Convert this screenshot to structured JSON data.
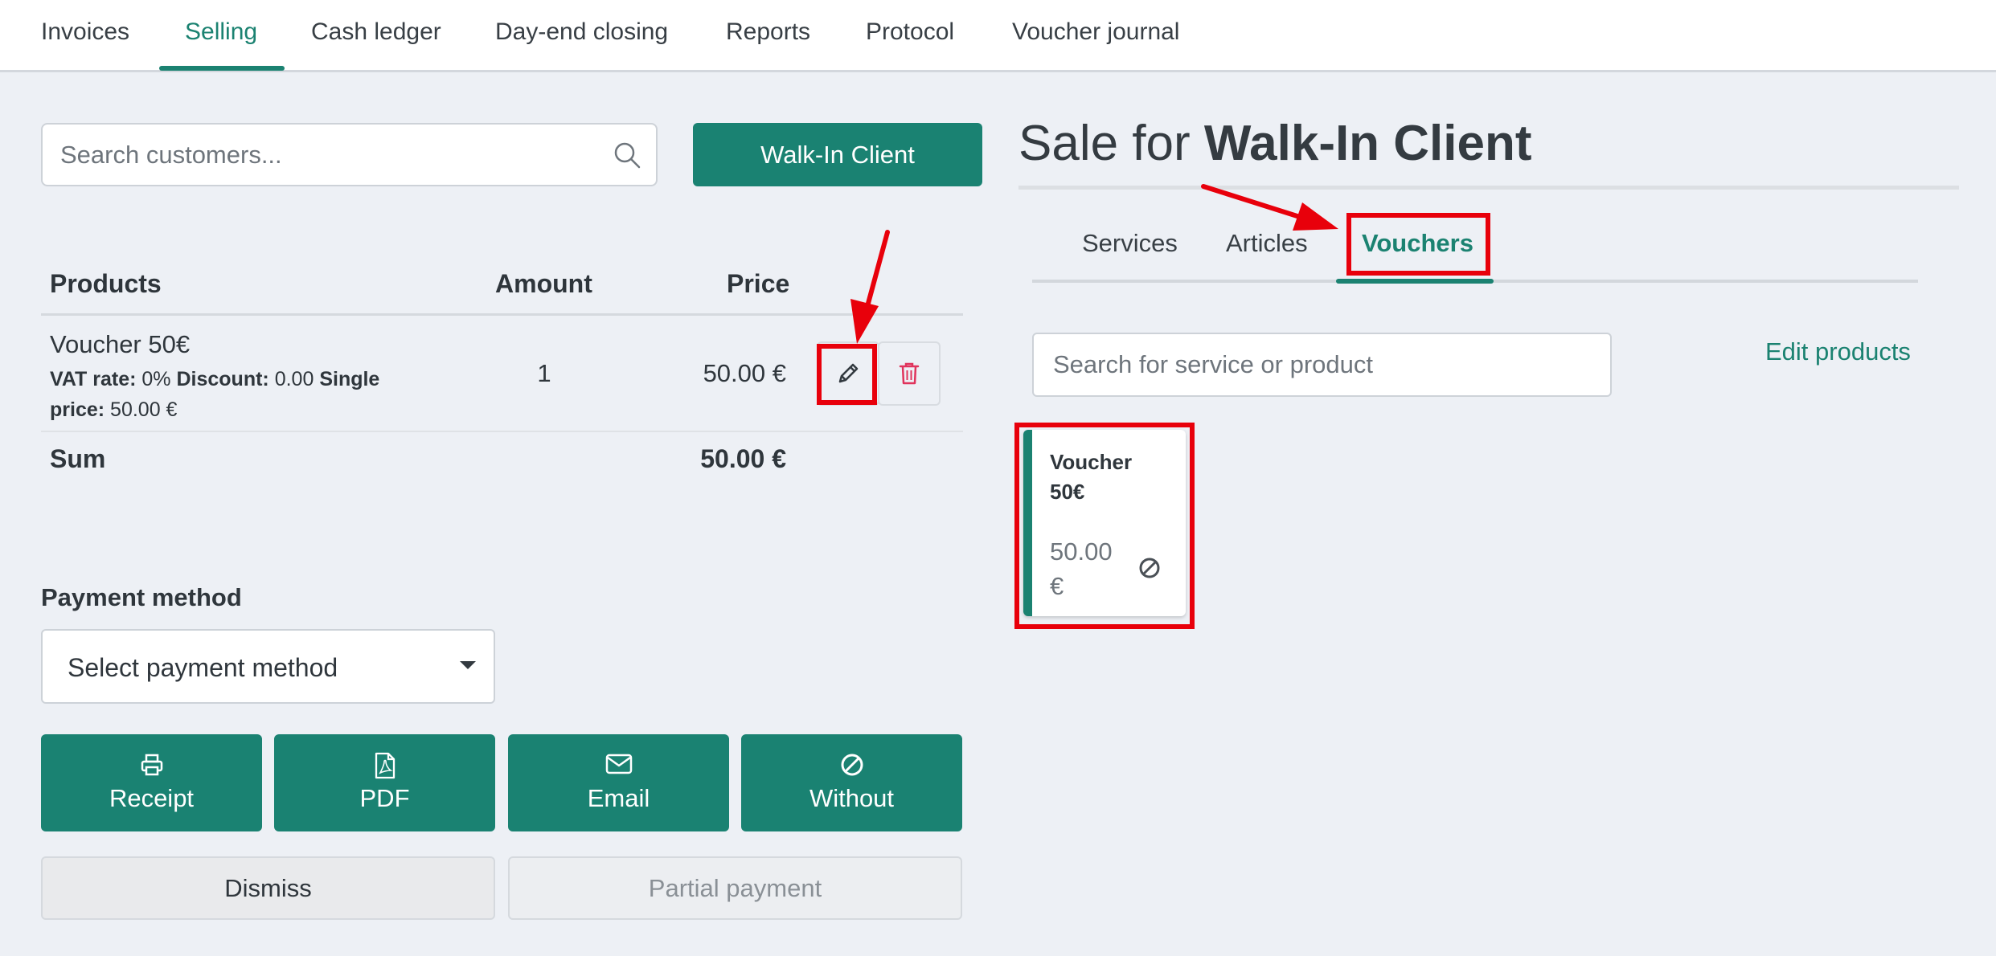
{
  "nav": {
    "items": [
      "Invoices",
      "Selling",
      "Cash ledger",
      "Day-end closing",
      "Reports",
      "Protocol",
      "Voucher journal"
    ],
    "active": "Selling"
  },
  "customer_search": {
    "placeholder": "Search customers...",
    "value": ""
  },
  "walkin_button": "Walk-In Client",
  "products_table": {
    "headers": {
      "products": "Products",
      "amount": "Amount",
      "price": "Price"
    },
    "rows": [
      {
        "name": "Voucher 50€",
        "vat_label": "VAT rate:",
        "vat_value": "0%",
        "discount_label": "Discount:",
        "discount_value": "0.00",
        "single_price_label": "Single price:",
        "single_price_value": "50.00 €",
        "amount": "1",
        "price": "50.00 €"
      }
    ],
    "sum_label": "Sum",
    "sum_value": "50.00 €"
  },
  "payment": {
    "label": "Payment method",
    "select_value": "Select payment method"
  },
  "actions": {
    "receipt": "Receipt",
    "pdf": "PDF",
    "email": "Email",
    "without": "Without",
    "dismiss": "Dismiss",
    "partial": "Partial payment"
  },
  "sale": {
    "title_prefix": "Sale for",
    "client": "Walk-In Client"
  },
  "tabs": {
    "items": [
      "Services",
      "Articles",
      "Vouchers"
    ],
    "active": "Vouchers"
  },
  "product_search": {
    "placeholder": "Search for service or product",
    "value": ""
  },
  "edit_products": "Edit products",
  "voucher_card": {
    "name": "Voucher 50€",
    "price": "50.00 €"
  },
  "colors": {
    "accent": "#1b8271",
    "button": "#1a8272",
    "annotation": "#e8000b",
    "delete": "#e0335c",
    "background": "#edf0f5"
  }
}
